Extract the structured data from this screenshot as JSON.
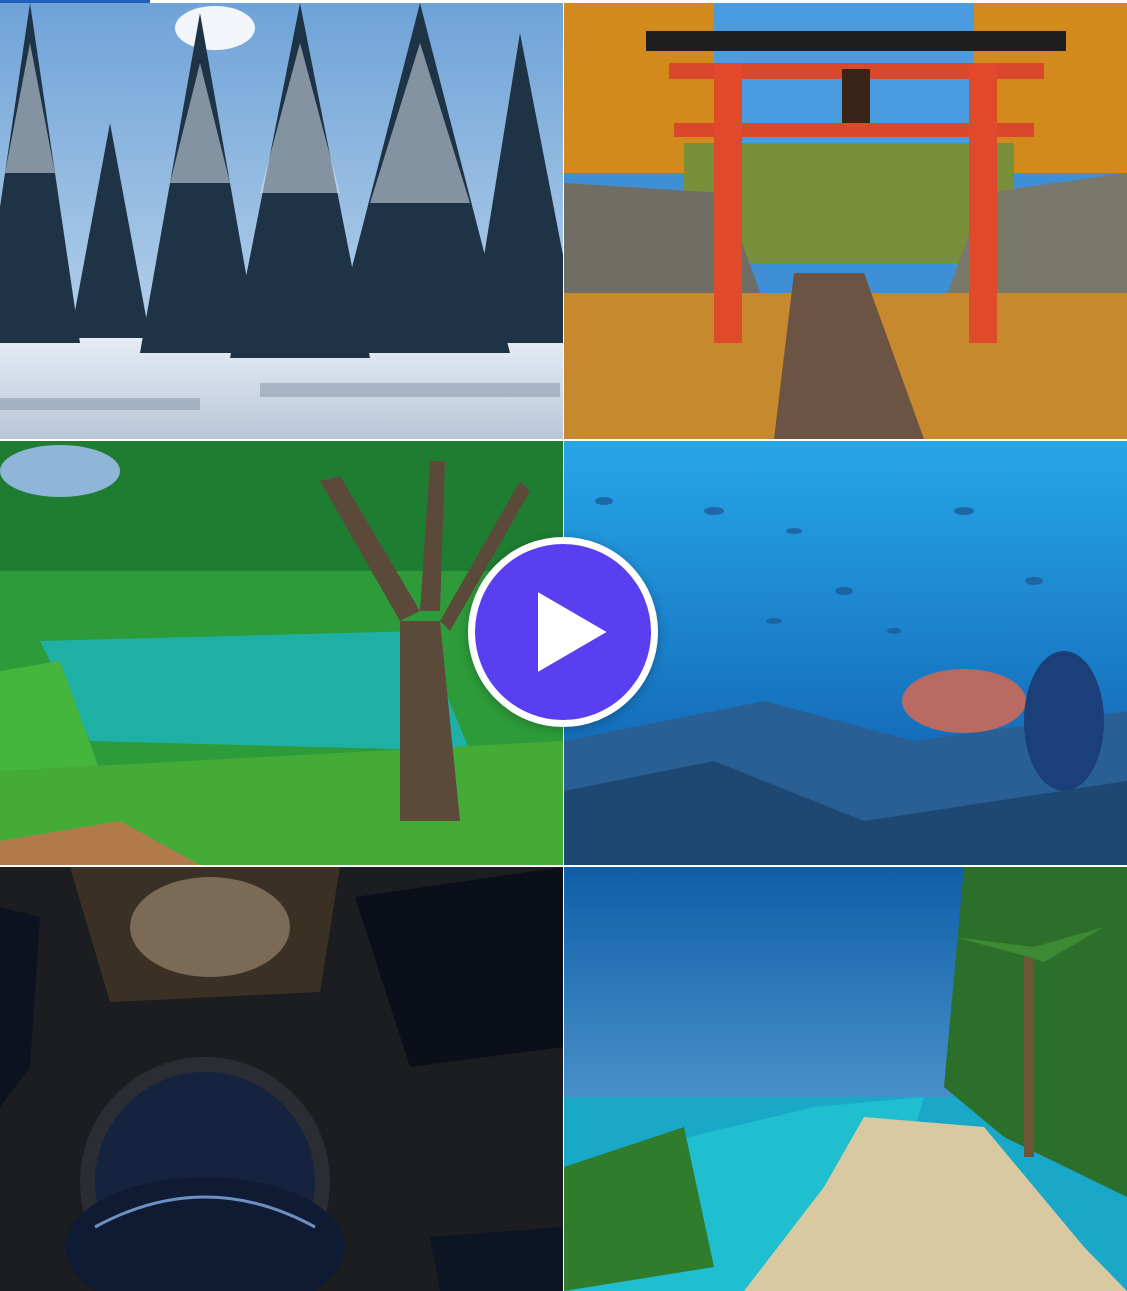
{
  "gallery": {
    "tiles": [
      {
        "scene": "snowy-forest"
      },
      {
        "scene": "autumn-torii-gate"
      },
      {
        "scene": "forest-lake"
      },
      {
        "scene": "underwater-reef"
      },
      {
        "scene": "space-station-window"
      },
      {
        "scene": "tropical-beach"
      }
    ]
  },
  "play_button": {
    "icon": "play-icon",
    "color": "#5a3ff0"
  }
}
